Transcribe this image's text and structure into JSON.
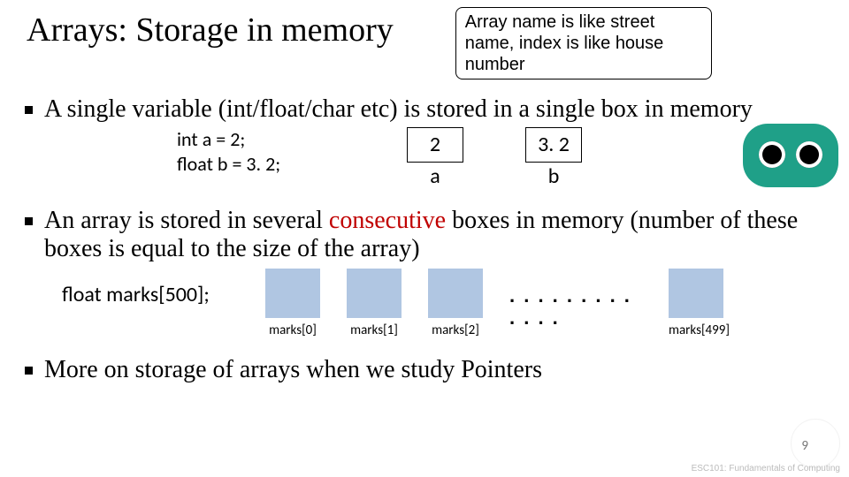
{
  "title": "Arrays: Storage in memory",
  "callout": "Array name is like street name, index is like house number",
  "bullet1": "A single variable (int/float/char etc) is stored in a single box in memory",
  "code1_line1": "int a  = 2;",
  "code1_line2": "float b = 3. 2;",
  "box_a": {
    "value": "2",
    "label": "a"
  },
  "box_b": {
    "value": "3. 2",
    "label": "b"
  },
  "bullet2_pre": "An array is stored in several ",
  "bullet2_red": "consecutive",
  "bullet2_post": " boxes in memory (number of these boxes is equal to the size of the array)",
  "array_decl": "float marks[500];",
  "arr_labels": [
    "marks[0]",
    "marks[1]",
    "marks[2]",
    "marks[499]"
  ],
  "dots": ". . . . . . . . . . . . .",
  "bullet3": "More on storage of arrays when we study Pointers",
  "pagenum": "9",
  "watermark_text": "ESC101: Fundamentals of Computing"
}
